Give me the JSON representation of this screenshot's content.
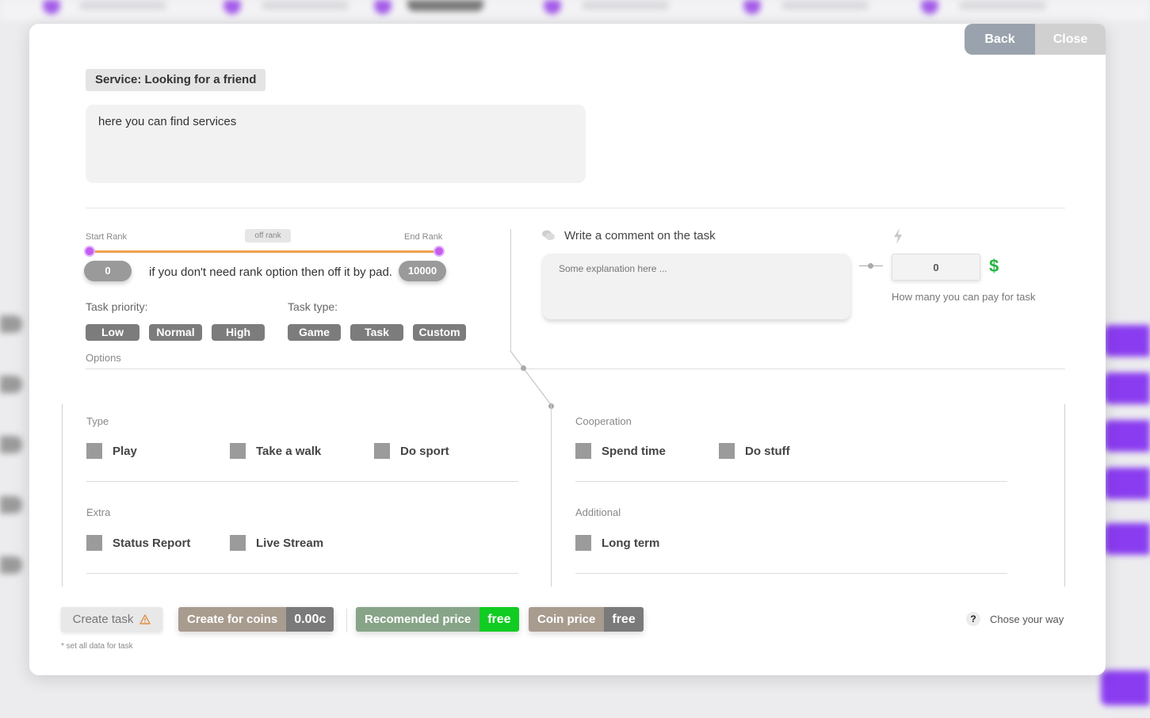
{
  "window": {
    "back_label": "Back",
    "close_label": "Close"
  },
  "service": {
    "tag": "Service: Looking for a friend",
    "description": "here you can find services"
  },
  "rank": {
    "start_label": "Start Rank",
    "end_label": "End Rank",
    "off_rank_label": "off rank",
    "start_value": "0",
    "end_value": "10000",
    "hint": "if you don't need rank option then off it by pad."
  },
  "priority": {
    "label": "Task priority:",
    "options": [
      "Low",
      "Normal",
      "High"
    ]
  },
  "task_type": {
    "label": "Task type:",
    "options": [
      "Game",
      "Task",
      "Custom"
    ]
  },
  "options_label": "Options",
  "comment": {
    "title": "Write a comment on the task",
    "placeholder": "Some explanation here ..."
  },
  "payment": {
    "value": "0",
    "currency_symbol": "$",
    "hint": "How many you can pay for task"
  },
  "groups": {
    "type": {
      "title": "Type",
      "items": [
        "Play",
        "Take a walk",
        "Do sport"
      ]
    },
    "cooperation": {
      "title": "Cooperation",
      "items": [
        "Spend time",
        "Do stuff"
      ]
    },
    "extra": {
      "title": "Extra",
      "items": [
        "Status Report",
        "Live Stream"
      ]
    },
    "additional": {
      "title": "Additional",
      "items": [
        "Long term"
      ]
    }
  },
  "footer": {
    "create_task_label": "Create task",
    "create_note": "* set all data for task",
    "create_coins_label": "Create for coins",
    "create_coins_value": "0.00c",
    "recommended_label": "Recomended price",
    "recommended_value": "free",
    "coin_price_label": "Coin price",
    "coin_price_value": "free",
    "help_icon": "?",
    "help_label": "Chose your way"
  },
  "colors": {
    "knob": "#c45cf0",
    "track": "#f0a050",
    "free_green": "#11cc22",
    "dollar_green": "#22b544"
  }
}
